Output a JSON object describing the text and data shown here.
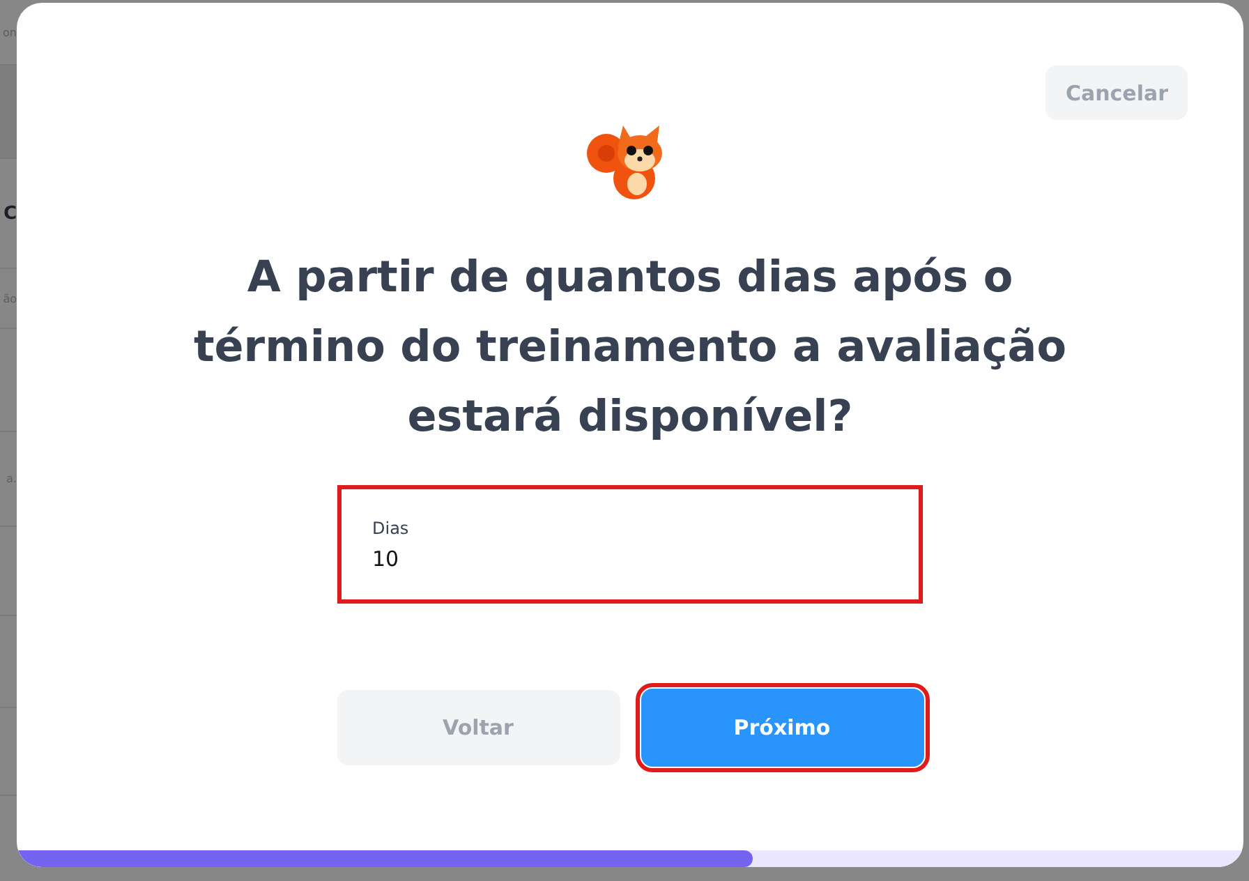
{
  "background_page": {
    "rows": [
      {
        "text": "on",
        "bold": false
      },
      {
        "text": "C",
        "bold": true
      },
      {
        "text": "ão",
        "bold": false
      },
      {
        "text": "a.",
        "bold": false
      }
    ]
  },
  "modal": {
    "cancel_button": "Cancelar",
    "question": "A partir de quantos dias após o término do treinamento a avaliação estará disponível?",
    "field": {
      "label": "Dias",
      "value": "10",
      "highlighted": true
    },
    "buttons": [
      {
        "kind": "secondary",
        "label": "Voltar",
        "highlighted": false
      },
      {
        "kind": "primary",
        "label": "Próximo",
        "highlighted": true
      }
    ],
    "progress": {
      "level": 0.6
    }
  }
}
